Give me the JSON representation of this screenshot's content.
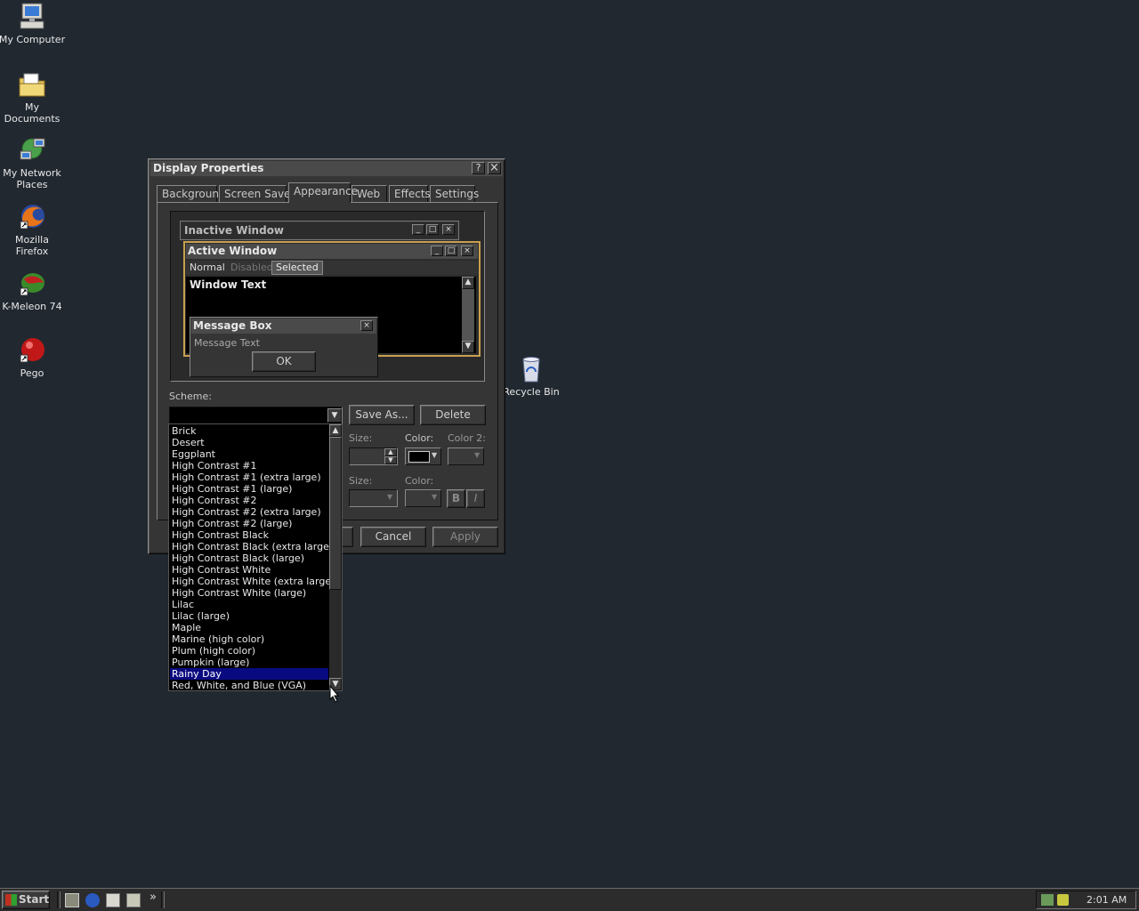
{
  "desktop": {
    "icons": [
      {
        "label": "My Computer"
      },
      {
        "label": "My Documents"
      },
      {
        "label": "My Network Places"
      },
      {
        "label": "Mozilla Firefox"
      },
      {
        "label": "K-Meleon 74"
      },
      {
        "label": "Pego"
      },
      {
        "label": "Recycle Bin"
      }
    ]
  },
  "dialog": {
    "title": "Display Properties",
    "help_glyph": "?",
    "close_glyph": "×",
    "tabs": [
      {
        "label": "Background"
      },
      {
        "label": "Screen Saver"
      },
      {
        "label": "Appearance"
      },
      {
        "label": "Web"
      },
      {
        "label": "Effects"
      },
      {
        "label": "Settings"
      }
    ],
    "preview": {
      "inactive_title": "Inactive Window",
      "active_title": "Active Window",
      "menu_normal": "Normal",
      "menu_disabled": "Disabled",
      "menu_selected": "Selected",
      "window_text": "Window Text",
      "msgbox_title": "Message Box",
      "msgbox_text": "Message Text",
      "msgbox_ok": "OK"
    },
    "scheme_label": "Scheme:",
    "save_as_label": "Save As...",
    "delete_label": "Delete",
    "size_label": "Size:",
    "color_label": "Color:",
    "color2_label": "Color 2:",
    "size2_label": "Size:",
    "color3_label": "Color:",
    "bold_label": "B",
    "italic_label": "I",
    "cancel_label": "Cancel",
    "apply_label": "Apply",
    "scheme_options": [
      "Brick",
      "Desert",
      "Eggplant",
      "High Contrast #1",
      "High Contrast #1 (extra large)",
      "High Contrast #1 (large)",
      "High Contrast #2",
      "High Contrast #2 (extra large)",
      "High Contrast #2 (large)",
      "High Contrast Black",
      "High Contrast Black (extra large)",
      "High Contrast Black (large)",
      "High Contrast White",
      "High Contrast White (extra large)",
      "High Contrast White (large)",
      "Lilac",
      "Lilac (large)",
      "Maple",
      "Marine (high color)",
      "Plum (high color)",
      "Pumpkin (large)",
      "Rainy Day",
      "Red, White, and Blue (VGA)"
    ],
    "selected_scheme": "Rainy Day"
  },
  "taskbar": {
    "start_label": "Start",
    "clock": "2:01 AM",
    "chevron": "»"
  },
  "colors": {
    "desktop_bg": "#212830",
    "selection": "#0a0a80",
    "window_face": "#353535"
  }
}
